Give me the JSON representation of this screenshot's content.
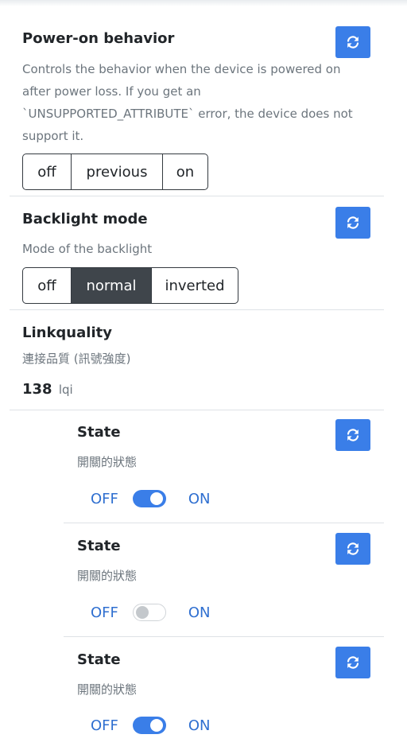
{
  "power_on": {
    "title": "Power-on behavior",
    "description": "Controls the behavior when the device is powered on after power loss. If you get an `UNSUPPORTED_ATTRIBUTE` error, the device does not support it.",
    "options": [
      "off",
      "previous",
      "on"
    ],
    "selected": null
  },
  "backlight": {
    "title": "Backlight mode",
    "description": "Mode of the backlight",
    "options": [
      "off",
      "normal",
      "inverted"
    ],
    "selected": "normal"
  },
  "linkquality": {
    "title": "Linkquality",
    "description": "連接品質 (訊號強度)",
    "value": "138",
    "unit": "lqi"
  },
  "states": [
    {
      "title": "State",
      "description": "開關的狀態",
      "off_label": "OFF",
      "on_label": "ON",
      "is_on": true
    },
    {
      "title": "State",
      "description": "開關的狀態",
      "off_label": "OFF",
      "on_label": "ON",
      "is_on": false
    },
    {
      "title": "State",
      "description": "開關的狀態",
      "off_label": "OFF",
      "on_label": "ON",
      "is_on": true
    }
  ],
  "colors": {
    "accent": "#3a7ee8",
    "active_option": "#3f454b",
    "link_text": "#2f6fd0"
  },
  "icons": {
    "refresh": "refresh-icon"
  }
}
